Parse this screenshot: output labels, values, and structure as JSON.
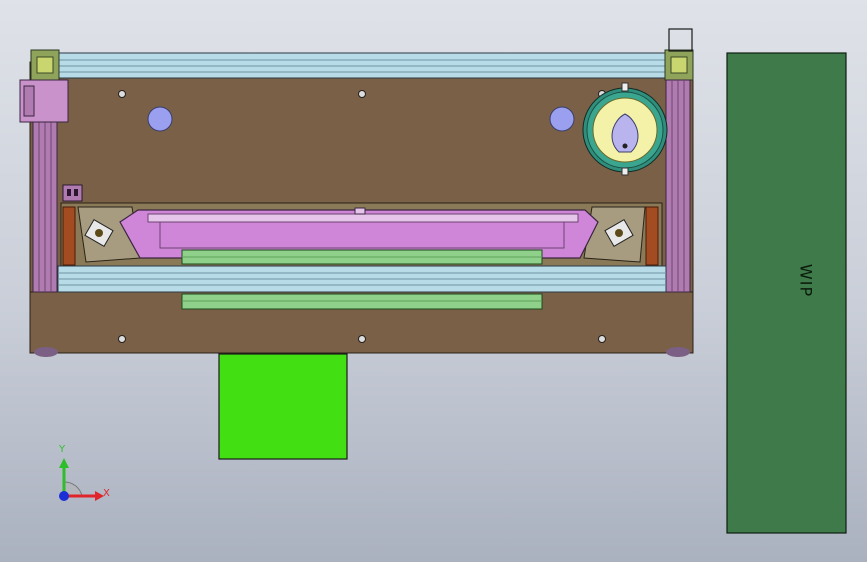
{
  "viewport": {
    "background": "gradient-gray",
    "orientation": "top-view"
  },
  "model": {
    "frame_color": "#7a6046",
    "rail_color": "#b8dbe8",
    "post_color": "#b07bb1",
    "tray_color": "#cf86d8",
    "roller_color": "#8fd08a",
    "disk_color": "#f4f2a8",
    "ring_color": "#2f8e7c",
    "hole_color": "#9a9ff0"
  },
  "green_block": {
    "color": "#42e012"
  },
  "wip_box": {
    "label": "WIP",
    "color": "#3f7a4a"
  },
  "triad": {
    "x_label": "X",
    "y_label": "Y",
    "x_color": "#e0242a",
    "y_color": "#2fbe2b",
    "z_color": "#1a2fd6"
  }
}
